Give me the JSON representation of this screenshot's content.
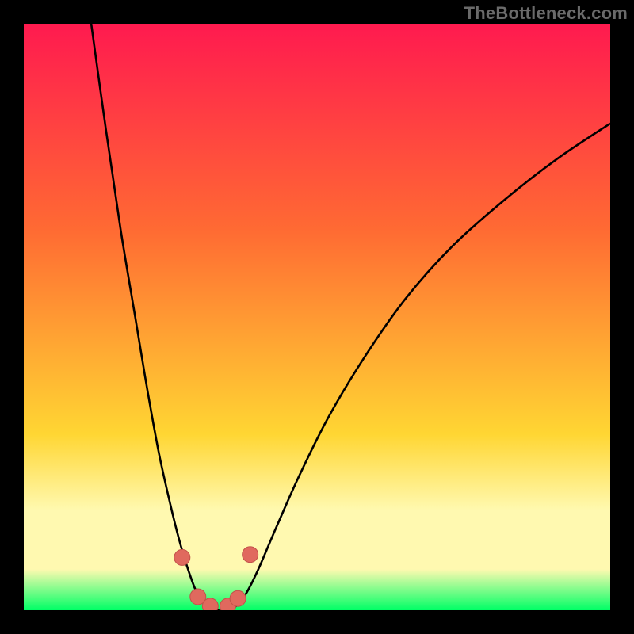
{
  "watermark": "TheBottleneck.com",
  "colors": {
    "frame_bg": "#000000",
    "grad_top": "#ff1a4f",
    "grad_mid1": "#ff6a33",
    "grad_mid2": "#ffd633",
    "grad_band": "#fff9b0",
    "grad_bottom": "#00ff66",
    "curve_stroke": "#000000",
    "marker_fill": "#e0695e",
    "marker_stroke": "#c2514a"
  },
  "chart_data": {
    "type": "line",
    "title": "",
    "xlabel": "",
    "ylabel": "",
    "xlim": [
      0,
      100
    ],
    "ylim": [
      0,
      100
    ],
    "curve": [
      {
        "x": 11.5,
        "y": 100
      },
      {
        "x": 14.0,
        "y": 82
      },
      {
        "x": 16.5,
        "y": 65
      },
      {
        "x": 19.0,
        "y": 50
      },
      {
        "x": 21.0,
        "y": 38
      },
      {
        "x": 23.0,
        "y": 27
      },
      {
        "x": 25.0,
        "y": 18
      },
      {
        "x": 26.5,
        "y": 12
      },
      {
        "x": 28.0,
        "y": 7
      },
      {
        "x": 29.5,
        "y": 3
      },
      {
        "x": 31.0,
        "y": 1
      },
      {
        "x": 33.0,
        "y": 0
      },
      {
        "x": 35.0,
        "y": 0
      },
      {
        "x": 36.5,
        "y": 1
      },
      {
        "x": 38.0,
        "y": 3
      },
      {
        "x": 40.0,
        "y": 7
      },
      {
        "x": 43.0,
        "y": 14
      },
      {
        "x": 47.0,
        "y": 23
      },
      {
        "x": 52.0,
        "y": 33
      },
      {
        "x": 58.0,
        "y": 43
      },
      {
        "x": 65.0,
        "y": 53
      },
      {
        "x": 73.0,
        "y": 62
      },
      {
        "x": 82.0,
        "y": 70
      },
      {
        "x": 91.0,
        "y": 77
      },
      {
        "x": 100.0,
        "y": 83
      }
    ],
    "markers": [
      {
        "x": 27.0,
        "y": 9.0,
        "r": 1.5
      },
      {
        "x": 29.7,
        "y": 2.3,
        "r": 1.5
      },
      {
        "x": 31.8,
        "y": 0.7,
        "r": 1.5
      },
      {
        "x": 34.8,
        "y": 0.7,
        "r": 1.5
      },
      {
        "x": 36.5,
        "y": 2.0,
        "r": 1.5
      },
      {
        "x": 38.6,
        "y": 9.5,
        "r": 1.5
      }
    ],
    "gradient_stops": [
      {
        "offset": 0.0,
        "key": "grad_top"
      },
      {
        "offset": 0.35,
        "key": "grad_mid1"
      },
      {
        "offset": 0.7,
        "key": "grad_mid2"
      },
      {
        "offset": 0.83,
        "key": "grad_band"
      },
      {
        "offset": 0.93,
        "key": "grad_band"
      },
      {
        "offset": 1.0,
        "key": "grad_bottom"
      }
    ]
  }
}
